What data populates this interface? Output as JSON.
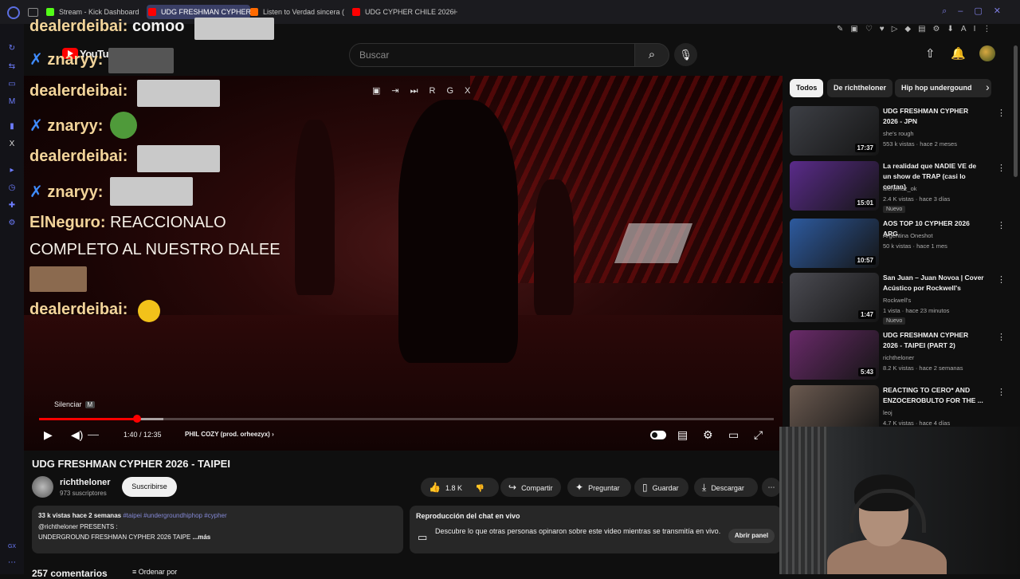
{
  "browser": {
    "tabs": [
      {
        "title": "Stream - Kick Dashboard",
        "color": "#53fc18"
      },
      {
        "title": "UDG FRESHMAN CYPHER",
        "color": "#ff0000"
      },
      {
        "title": "Listen to Verdad sincera (",
        "color": "#ff6a00"
      },
      {
        "title": "UDG CYPHER CHILE 2026",
        "color": "#ff0000"
      }
    ]
  },
  "header": {
    "logo_text": "YouTube",
    "search_placeholder": "Buscar"
  },
  "chat_overlay": {
    "lines": [
      {
        "user": "dealerdeibai",
        "msg": "comoo"
      },
      {
        "user": "znaryy",
        "msg": ""
      },
      {
        "user": "dealerdeibai",
        "msg": ""
      },
      {
        "user": "znaryy",
        "msg": ""
      },
      {
        "user": "dealerdeibai",
        "msg": ""
      },
      {
        "user": "znaryy",
        "msg": ""
      },
      {
        "user": "ElNeguro",
        "msg": "REACCIONALO"
      },
      {
        "user": "",
        "msg": "COMPLETO AL NUESTRO DALEE"
      },
      {
        "user": "dealerdeibai",
        "msg": ""
      }
    ]
  },
  "player": {
    "tooltip": "Silenciar",
    "tooltip_key": "M",
    "time": "1:40 / 12:35",
    "chapter": "PHIL COZY (prod. orheezyx)",
    "progress": 0.133
  },
  "video": {
    "title": "UDG FRESHMAN CYPHER 2026 - TAIPEI",
    "channel": "richtheloner",
    "subscribers": "973 suscriptores",
    "subscribe_label": "Suscribirse",
    "likes": "1.8 K",
    "share": "Compartir",
    "ask": "Preguntar",
    "save": "Guardar",
    "download": "Descargar"
  },
  "description": {
    "views": "33 k vistas",
    "date": "hace 2 semanas",
    "tags": "#taipei #undergroundhiphop #cypher",
    "line1": "@richtheloner PRESENTS :",
    "line2": "UNDERGROUND FRESHMAN CYPHER 2026 TAIPE",
    "more": "...más"
  },
  "livechat": {
    "title": "Reproducción del chat en vivo",
    "text": "Descubre lo que otras personas opinaron sobre este video mientras se transmitía en vivo.",
    "button": "Abrir panel"
  },
  "comments": {
    "count": "257 comentarios",
    "sort": "Ordenar por"
  },
  "chips": [
    "Todos",
    "De richtheloner",
    "Hip hop undergound"
  ],
  "recommendations": [
    {
      "title": "UDG FRESHMAN CYPHER 2026 - JPN",
      "channel": "she's rough",
      "meta": "553 k vistas · hace 2 meses",
      "duration": "17:37",
      "badge": "",
      "thumb": "#3d3f45"
    },
    {
      "title": "La realidad que NADIE VE de un show de TRAP (casi lo cortan)",
      "channel": "alenunez_ok",
      "meta": "2.4 K vistas · hace 3 días",
      "duration": "15:01",
      "badge": "Nuevo",
      "thumb": "#5a2b8a"
    },
    {
      "title": "AOS TOP 10 CYPHER 2026 ARG",
      "channel": "Argentina Oneshot",
      "meta": "50 k vistas · hace 1 mes",
      "duration": "10:57",
      "badge": "",
      "thumb": "#2d5a9e"
    },
    {
      "title": "San Juan – Juan Novoa | Cover Acústico por Rockwell's",
      "channel": "Rockwell's",
      "meta": "1 vista · hace 23 minutos",
      "duration": "1:47",
      "badge": "Nuevo",
      "thumb": "#4b4b52"
    },
    {
      "title": "UDG FRESHMAN CYPHER 2026 - TAIPEI (PART 2)",
      "channel": "richtheloner",
      "meta": "8.2 K vistas · hace 2 semanas",
      "duration": "5:43",
      "badge": "",
      "thumb": "#6a2a6a"
    },
    {
      "title": "REACTING TO CERO* AND ENZOCEROBULTO FOR THE ...",
      "channel": "leoj",
      "meta": "4.7 K vistas · hace 4 días",
      "duration": "",
      "badge": "",
      "thumb": "#6b5a50"
    }
  ]
}
